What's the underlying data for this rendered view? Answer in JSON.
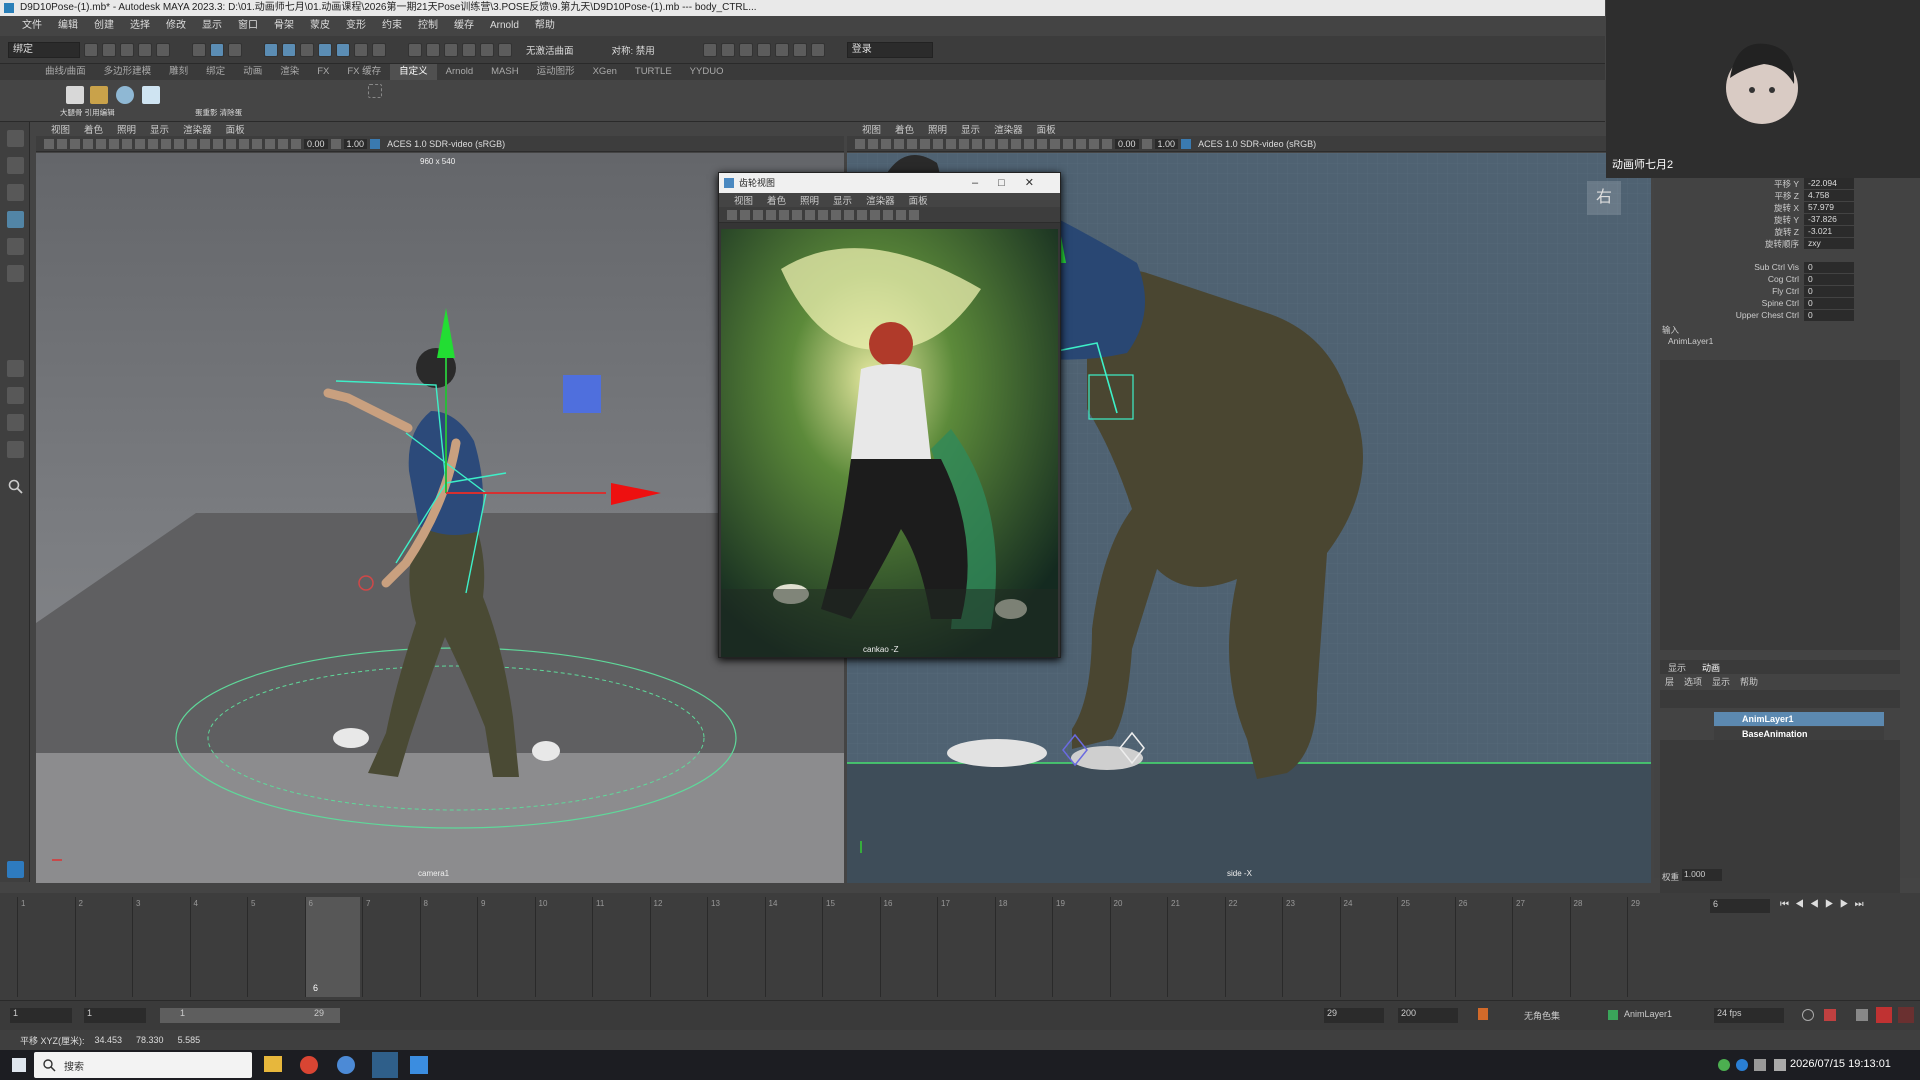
{
  "titlebar": {
    "title": "D9D10Pose-(1).mb* - Autodesk MAYA 2023.3: D:\\01.动画师七月\\01.动画课程\\2026第一期21天Pose训练营\\3.POSE反馈\\9.第九天\\D9D10Pose-(1).mb   ---   body_CTRL..."
  },
  "menubar": {
    "items": [
      "文件",
      "编辑",
      "创建",
      "选择",
      "修改",
      "显示",
      "窗口",
      "骨架",
      "蒙皮",
      "变形",
      "约束",
      "控制",
      "缓存",
      "Arnold",
      "帮助"
    ]
  },
  "statusline": {
    "mode": "绑定",
    "symmetry_label": "无激活曲面",
    "symmetry": "对称: 禁用",
    "login": "登录"
  },
  "shelf": {
    "tabs": [
      "曲线/曲面",
      "多边形建模",
      "雕刻",
      "绑定",
      "动画",
      "渲染",
      "FX",
      "FX 缓存",
      "自定义",
      "Arnold",
      "MASH",
      "运动图形",
      "XGen",
      "TURTLE",
      "YYDUO"
    ],
    "active_tab": "自定义",
    "labels": [
      "大腿骨 引用编辑",
      "蛋重影 清除蛋"
    ]
  },
  "viewport_left": {
    "menu": [
      "视图",
      "着色",
      "照明",
      "显示",
      "渲染器",
      "面板"
    ],
    "num1": "0.00",
    "num2": "1.00",
    "colorspace": "ACES 1.0 SDR-video (sRGB)",
    "resolution": "960 x 540",
    "camera": "camera1"
  },
  "viewport_right": {
    "menu": [
      "视图",
      "着色",
      "照明",
      "显示",
      "渲染器",
      "面板"
    ],
    "num1": "0.00",
    "num2": "1.00",
    "colorspace": "ACES 1.0 SDR-video (sRGB)",
    "camera": "side -X",
    "cam_label": "右"
  },
  "ref_window": {
    "title": "齿轮视图",
    "menu": [
      "视图",
      "着色",
      "照明",
      "显示",
      "渲染器",
      "面板"
    ],
    "caption": "cankao -Z"
  },
  "webcam": {
    "name": "动画师七月2"
  },
  "channelbox": {
    "attributes": [
      {
        "k": "平移 Y",
        "v": "-22.094"
      },
      {
        "k": "平移 Z",
        "v": "4.758"
      },
      {
        "k": "旋转 X",
        "v": "57.979"
      },
      {
        "k": "旋转 Y",
        "v": "-37.826"
      },
      {
        "k": "旋转 Z",
        "v": "-3.021"
      },
      {
        "k": "旋转顺序",
        "v": "zxy"
      },
      {
        "k": "Sub Ctrl Vis",
        "v": "0"
      },
      {
        "k": "Cog Ctrl",
        "v": "0"
      },
      {
        "k": "Fly Ctrl",
        "v": "0"
      },
      {
        "k": "Spine Ctrl",
        "v": "0"
      },
      {
        "k": "Upper Chest Ctrl",
        "v": "0"
      }
    ],
    "input_label": "输入",
    "input_node": "AnimLayer1",
    "layer_tabs": [
      "显示",
      "动画"
    ],
    "layer_menu": [
      "层",
      "选项",
      "显示",
      "帮助"
    ],
    "layers": [
      "AnimLayer1",
      "BaseAnimation"
    ],
    "weight_label": "权重",
    "weight": "1.000"
  },
  "timeline": {
    "frames": [
      "1",
      "2",
      "3",
      "4",
      "5",
      "6",
      "7",
      "8",
      "9",
      "10",
      "11",
      "12",
      "13",
      "14",
      "15",
      "16",
      "17",
      "18",
      "19",
      "20",
      "21",
      "22",
      "23",
      "24",
      "25",
      "26",
      "27",
      "28",
      "29"
    ],
    "current_frame": "6",
    "current_field": "6"
  },
  "range": {
    "start": "1",
    "start2": "1",
    "slider_start": "1",
    "slider_end": "29",
    "end": "29",
    "end2": "200",
    "char_set": "无角色集",
    "anim_layer": "AnimLayer1",
    "fps": "24 fps"
  },
  "cmdline": {
    "label": "平移 XYZ(厘米):",
    "x": "34.453",
    "y": "78.330",
    "z": "5.585"
  },
  "taskbar": {
    "search": "搜索",
    "datetime": "2026/07/15 19:13:01"
  }
}
